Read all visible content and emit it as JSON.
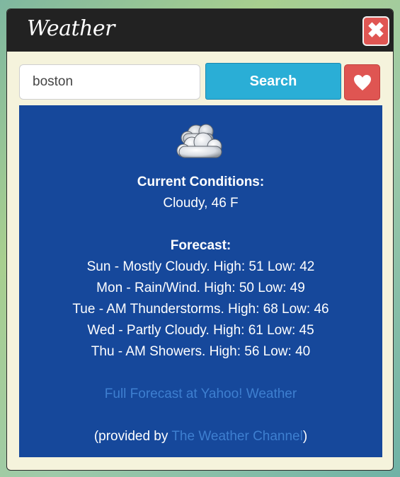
{
  "widget": {
    "title": "Weather",
    "close_label": "✖"
  },
  "search": {
    "value": "boston",
    "button_label": "Search"
  },
  "conditions": {
    "icon": "cloudy-icon",
    "heading": "Current Conditions:",
    "value": "Cloudy, 46 F"
  },
  "forecast": {
    "heading": "Forecast:",
    "days": [
      "Sun - Mostly Cloudy. High: 51 Low: 42",
      "Mon - Rain/Wind. High: 50 Low: 49",
      "Tue - AM Thunderstorms. High: 68 Low: 46",
      "Wed - Partly Cloudy. High: 61 Low: 45",
      "Thu - AM Showers. High: 56 Low: 40"
    ]
  },
  "links": {
    "full_forecast": "Full Forecast at Yahoo! Weather",
    "provided_prefix": "(provided by ",
    "provider": "The Weather Channel",
    "provided_suffix": ")"
  },
  "colors": {
    "panel": "#16489b",
    "titlebar": "#222222",
    "search_button": "#2aaed6",
    "danger": "#df5552",
    "link": "#3e7fd0"
  }
}
